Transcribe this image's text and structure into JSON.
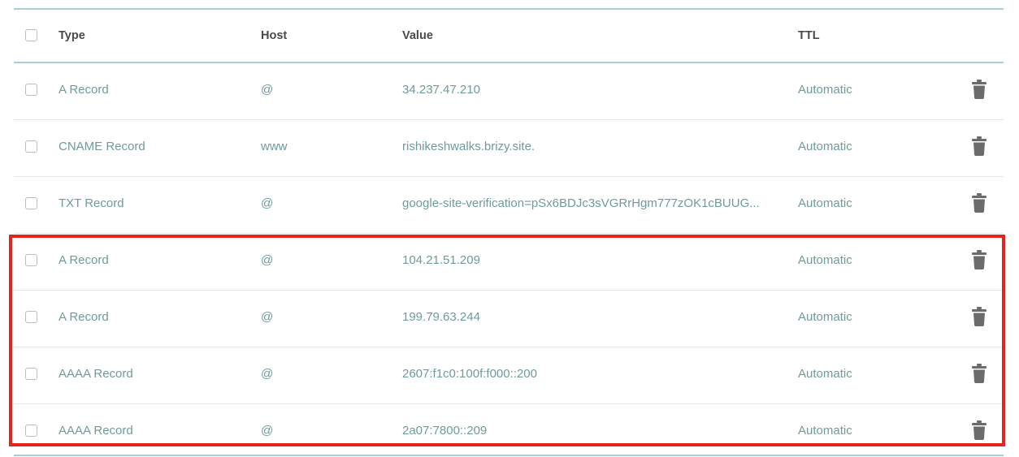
{
  "table": {
    "headers": {
      "type": "Type",
      "host": "Host",
      "value": "Value",
      "ttl": "TTL"
    },
    "rows": [
      {
        "type": "A Record",
        "host": "@",
        "value": "34.237.47.210",
        "ttl": "Automatic"
      },
      {
        "type": "CNAME Record",
        "host": "www",
        "value": "rishikeshwalks.brizy.site.",
        "ttl": "Automatic"
      },
      {
        "type": "TXT Record",
        "host": "@",
        "value": "google-site-verification=pSx6BDJc3sVGRrHgm777zOK1cBUUG...",
        "ttl": "Automatic"
      },
      {
        "type": "A Record",
        "host": "@",
        "value": "104.21.51.209",
        "ttl": "Automatic"
      },
      {
        "type": "A Record",
        "host": "@",
        "value": "199.79.63.244",
        "ttl": "Automatic"
      },
      {
        "type": "AAAA Record",
        "host": "@",
        "value": "2607:f1c0:100f:f000::200",
        "ttl": "Automatic"
      },
      {
        "type": "AAAA Record",
        "host": "@",
        "value": "2a07:7800::209",
        "ttl": "Automatic"
      }
    ]
  },
  "icons": {
    "delete": "trash-icon",
    "select": "checkbox"
  },
  "colors": {
    "accent_rule": "#a9cfd3",
    "row_text": "#6f9b9b",
    "header_text": "#4a4a4a",
    "highlight": "#e8231b",
    "trash": "#6b6b6b"
  }
}
